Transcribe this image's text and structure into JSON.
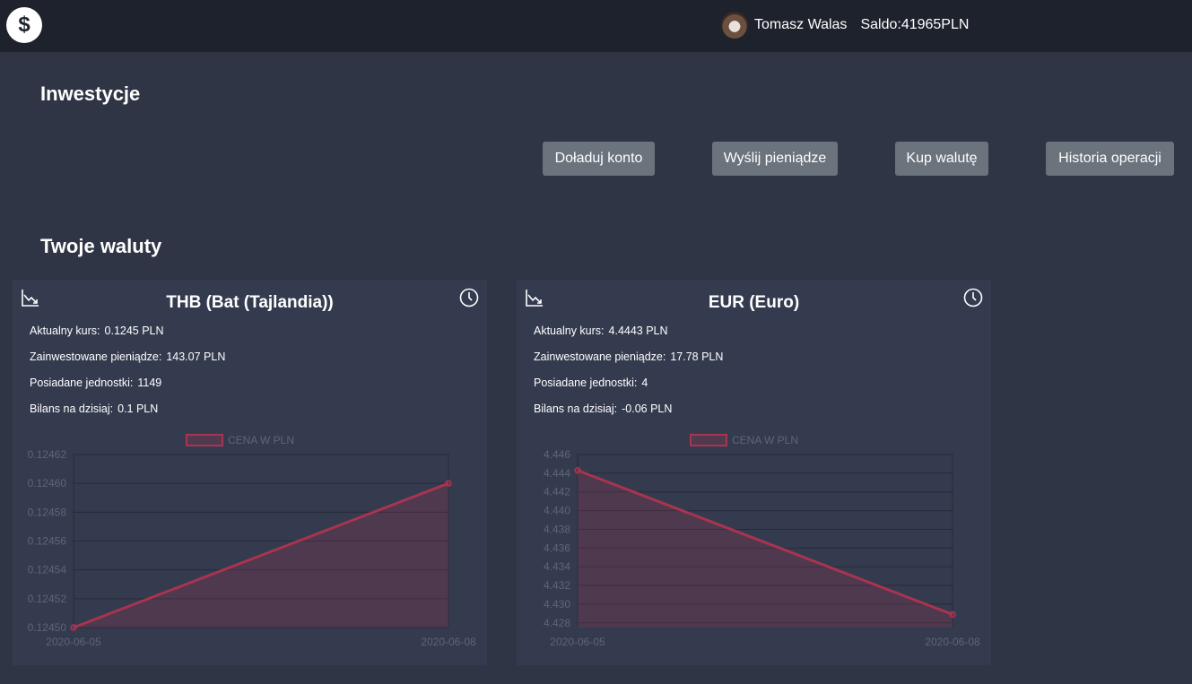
{
  "header": {
    "logo_symbol": "$",
    "user_name": "Tomasz Walas",
    "saldo_label": "Saldo:",
    "saldo_value": "41965PLN"
  },
  "page": {
    "investments_title": "Inwestycje",
    "currencies_title": "Twoje waluty"
  },
  "actions": {
    "topup": "Doładuj konto",
    "send": "Wyślij pieniądze",
    "buy": "Kup walutę",
    "history": "Historia operacji"
  },
  "colors": {
    "background": "#2f3545",
    "topbar": "#1d222c",
    "card": "#353b4f",
    "button": "#6b737c",
    "series": "#a8344f"
  },
  "cards": [
    {
      "title": "THB (Bat (Tajlandia))",
      "rate_label": "Aktualny kurs:",
      "rate_value": "0.1245 PLN",
      "invested_label": "Zainwestowane pieniądze:",
      "invested_value": "143.07 PLN",
      "units_label": "Posiadane jednostki:",
      "units_value": "1149",
      "balance_label": "Bilans na dzisiaj:",
      "balance_value": "0.1 PLN"
    },
    {
      "title": "EUR (Euro)",
      "rate_label": "Aktualny kurs:",
      "rate_value": "4.4443 PLN",
      "invested_label": "Zainwestowane pieniądze:",
      "invested_value": "17.78 PLN",
      "units_label": "Posiadane jednostki:",
      "units_value": "4",
      "balance_label": "Bilans na dzisiaj:",
      "balance_value": "-0.06 PLN"
    }
  ],
  "chart_data": [
    {
      "type": "area",
      "legend": "CENA W PLN",
      "legend_position": "top",
      "x": [
        "2020-06-05",
        "2020-06-08"
      ],
      "series": [
        {
          "name": "CENA W PLN",
          "values": [
            0.1245,
            0.1246
          ]
        }
      ],
      "yticks": [
        "0.12462",
        "0.12460",
        "0.12458",
        "0.12456",
        "0.12454",
        "0.12452",
        "0.12450"
      ],
      "ylim": [
        0.1245,
        0.12462
      ],
      "grid": true
    },
    {
      "type": "area",
      "legend": "CENA W PLN",
      "legend_position": "top",
      "x": [
        "2020-06-05",
        "2020-06-08"
      ],
      "series": [
        {
          "name": "CENA W PLN",
          "values": [
            4.4443,
            4.4289
          ]
        }
      ],
      "yticks": [
        "4.446",
        "4.444",
        "4.442",
        "4.440",
        "4.438",
        "4.436",
        "4.434",
        "4.432",
        "4.430",
        "4.428"
      ],
      "ylim": [
        4.4275,
        4.446
      ],
      "grid": true
    }
  ]
}
